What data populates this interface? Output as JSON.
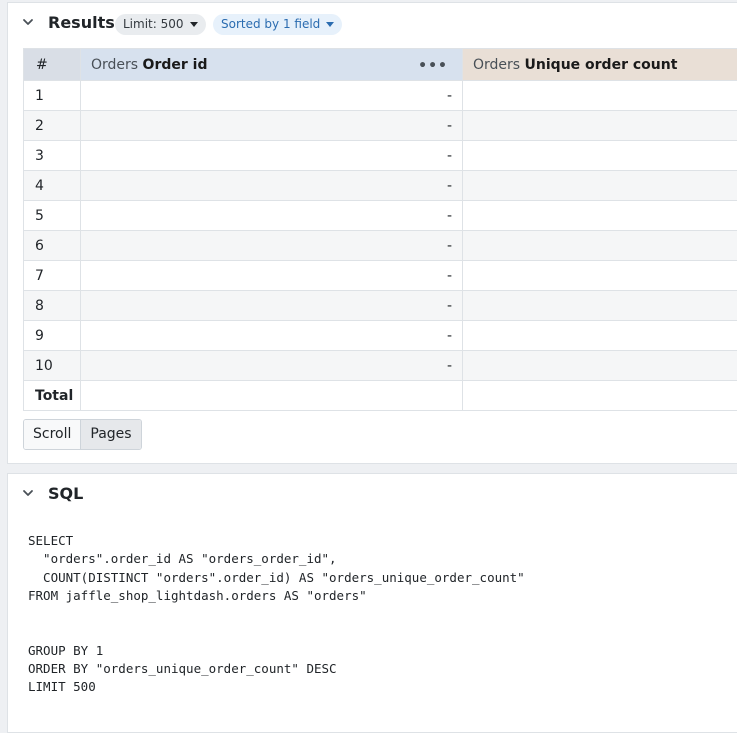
{
  "results": {
    "title": "Results",
    "limit_badge": "Limit: 500",
    "sort_badge": "Sorted by 1 field",
    "columns": [
      {
        "label": "#"
      },
      {
        "table": "Orders",
        "field": "Order id"
      },
      {
        "table": "Orders",
        "field": "Unique order count"
      }
    ],
    "rows": [
      {
        "index": "1",
        "order_id": "-",
        "count": ""
      },
      {
        "index": "2",
        "order_id": "-",
        "count": ""
      },
      {
        "index": "3",
        "order_id": "-",
        "count": ""
      },
      {
        "index": "4",
        "order_id": "-",
        "count": ""
      },
      {
        "index": "5",
        "order_id": "-",
        "count": ""
      },
      {
        "index": "6",
        "order_id": "-",
        "count": ""
      },
      {
        "index": "7",
        "order_id": "-",
        "count": ""
      },
      {
        "index": "8",
        "order_id": "-",
        "count": ""
      },
      {
        "index": "9",
        "order_id": "-",
        "count": ""
      },
      {
        "index": "10",
        "order_id": "-",
        "count": ""
      }
    ],
    "total_label": "Total",
    "view_modes": [
      "Scroll",
      "Pages"
    ],
    "active_view_mode": "Pages"
  },
  "sql": {
    "title": "SQL",
    "query": "SELECT\n  \"orders\".order_id AS \"orders_order_id\",\n  COUNT(DISTINCT \"orders\".order_id) AS \"orders_unique_order_count\"\nFROM jaffle_shop_lightdash.orders AS \"orders\"\n\n\nGROUP BY 1\nORDER BY \"orders_unique_order_count\" DESC\nLIMIT 500"
  },
  "icons": {
    "collapse": "chevron-down-icon",
    "dropdown": "caret-down-icon",
    "column_menu": "more-horizontal-icon"
  }
}
